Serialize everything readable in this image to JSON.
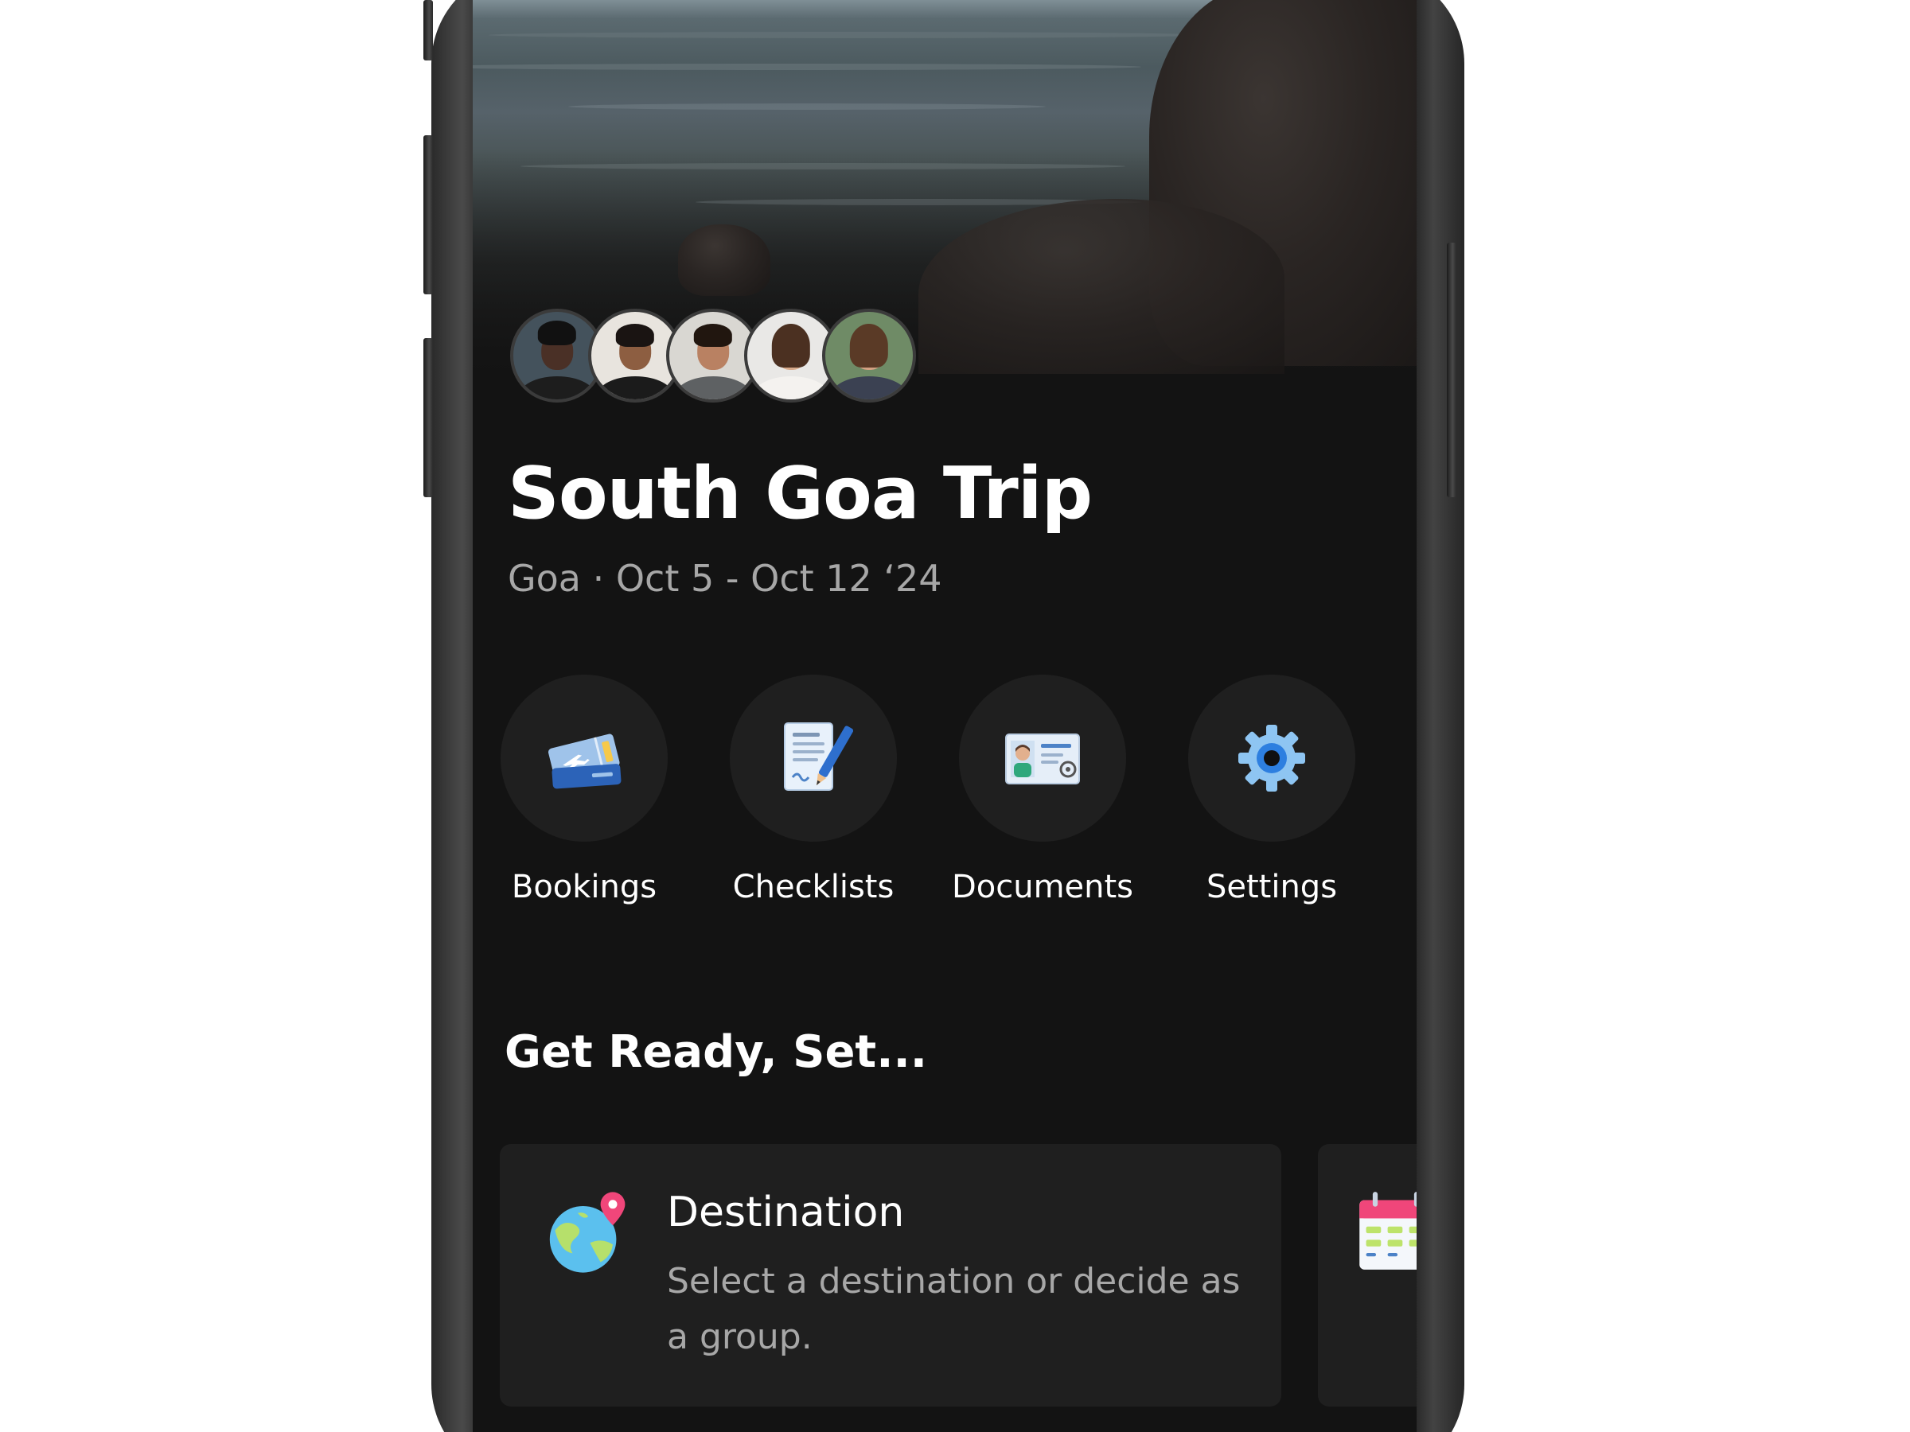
{
  "trip": {
    "title": "South Goa Trip",
    "subtitle": "Goa · Oct 5 - Oct 12 ‘24"
  },
  "members": [
    {
      "icon": "avatar-1"
    },
    {
      "icon": "avatar-2"
    },
    {
      "icon": "avatar-3"
    },
    {
      "icon": "avatar-4"
    },
    {
      "icon": "avatar-5"
    }
  ],
  "quick_actions": [
    {
      "label": "Bookings",
      "icon": "ticket-icon"
    },
    {
      "label": "Checklists",
      "icon": "checklist-icon"
    },
    {
      "label": "Documents",
      "icon": "id-card-icon"
    },
    {
      "label": "Settings",
      "icon": "gear-icon"
    }
  ],
  "section": {
    "title": "Get Ready, Set..."
  },
  "cards": [
    {
      "title": "Destination",
      "description": "Select a destination or decide as a group.",
      "icon": "globe-pin-icon"
    },
    {
      "icon": "calendar-icon"
    }
  ],
  "colors": {
    "background": "#131313",
    "surface": "#1f1f1f",
    "text_primary": "#ffffff",
    "text_secondary": "#a7a7a7"
  }
}
